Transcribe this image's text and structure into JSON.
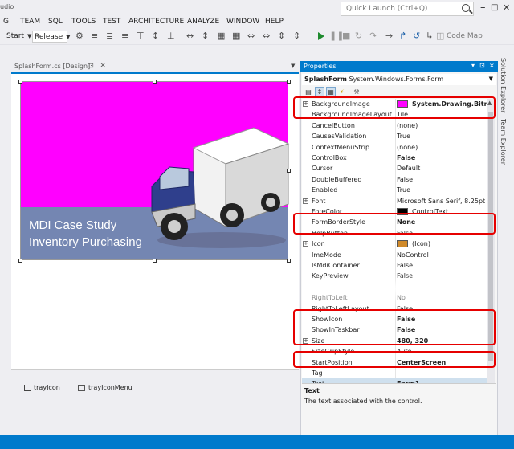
{
  "titlebar": {
    "app_fragment": "udio",
    "quick_launch": "Quick Launch (Ctrl+Q)"
  },
  "menu": [
    "G",
    "TEAM",
    "SQL",
    "TOOLS",
    "TEST",
    "ARCHITECTURE",
    "ANALYZE",
    "WINDOW",
    "HELP"
  ],
  "toolbar": {
    "start": "Start",
    "config": "Release",
    "code_map": "Code Map"
  },
  "doc_tab": {
    "label": "SplashForm.cs [Design]"
  },
  "splash": {
    "line1": "MDI Case Study",
    "line2": "Inventory Purchasing",
    "bg_color": "#ff00ff",
    "band_color": "#7486b2"
  },
  "tray": {
    "item1": "trayIcon",
    "item2": "trayIconMenu"
  },
  "properties": {
    "title": "Properties",
    "object_name": "SplashForm",
    "object_type": "System.Windows.Forms.Form",
    "rows": [
      {
        "name": "BackgroundImage",
        "value": "System.Drawing.Bitmap",
        "bold": true,
        "expand": true,
        "swatch": "#ff00ff"
      },
      {
        "name": "BackgroundImageLayout",
        "value": "Tile"
      },
      {
        "name": "CancelButton",
        "value": "(none)"
      },
      {
        "name": "CausesValidation",
        "value": "True"
      },
      {
        "name": "ContextMenuStrip",
        "value": "(none)"
      },
      {
        "name": "ControlBox",
        "value": "False",
        "bold": true
      },
      {
        "name": "Cursor",
        "value": "Default"
      },
      {
        "name": "DoubleBuffered",
        "value": "False"
      },
      {
        "name": "Enabled",
        "value": "True"
      },
      {
        "name": "Font",
        "value": "Microsoft Sans Serif, 8.25pt",
        "expand": true
      },
      {
        "name": "ForeColor",
        "value": "ControlText",
        "swatch": "#000000"
      },
      {
        "name": "FormBorderStyle",
        "value": "None",
        "bold": true
      },
      {
        "name": "HelpButton",
        "value": "False"
      },
      {
        "name": "Icon",
        "value": "(Icon)",
        "expand": true,
        "swatch": "#d08a2a"
      },
      {
        "name": "ImeMode",
        "value": "NoControl"
      },
      {
        "name": "IsMdiContainer",
        "value": "False"
      },
      {
        "name": "KeyPreview",
        "value": "False"
      },
      {
        "name": "",
        "value": ""
      },
      {
        "name": "RightToLeft",
        "value": "No"
      },
      {
        "name": "RightToLeftLayout",
        "value": "False"
      },
      {
        "name": "ShowIcon",
        "value": "False",
        "bold": true
      },
      {
        "name": "ShowInTaskbar",
        "value": "False",
        "bold": true
      },
      {
        "name": "Size",
        "value": "480, 320",
        "bold": true,
        "expand": true
      },
      {
        "name": "SizeGripStyle",
        "value": "Auto"
      },
      {
        "name": "StartPosition",
        "value": "CenterScreen",
        "bold": true
      },
      {
        "name": "Tag",
        "value": ""
      },
      {
        "name": "Text",
        "value": "Form1",
        "bold": true,
        "selected": true
      }
    ],
    "desc_title": "Text",
    "desc_text": "The text associated with the control."
  },
  "side_tabs": [
    "Solution Explorer",
    "Team Explorer"
  ],
  "colors": {
    "accent": "#007acc",
    "highlight": "#e60000"
  }
}
